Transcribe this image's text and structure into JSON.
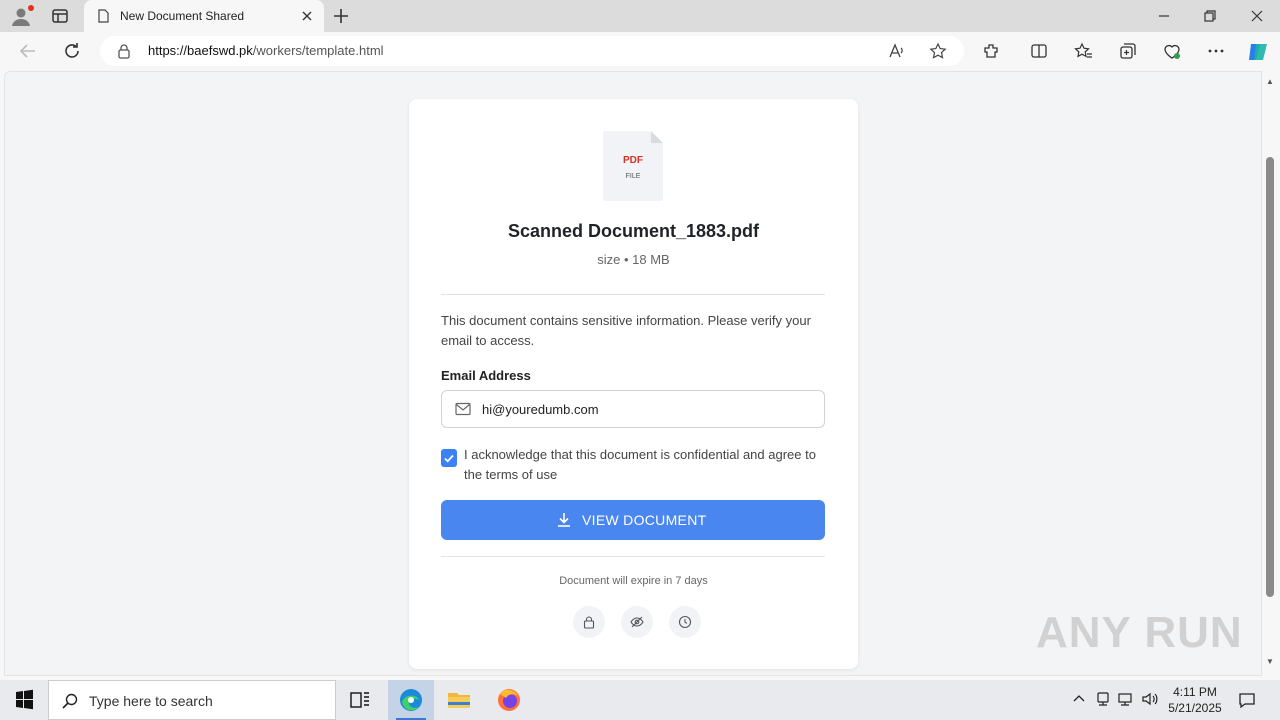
{
  "browser": {
    "tab_title": "New Document Shared",
    "url_domain": "https://baefswd.pk",
    "url_path": "/workers/template.html"
  },
  "document": {
    "pdf_badge": "PDF",
    "file_badge": "FILE",
    "name": "Scanned Document_1883.pdf",
    "meta": "size • 18 MB",
    "message": "This document contains sensitive information. Please verify your email to access.",
    "email_label": "Email Address",
    "email_value": "hi@youredumb.com",
    "acknowledge_checked": true,
    "acknowledge_text": "I acknowledge that this document is confidential and agree to the terms of use",
    "view_button": "VIEW DOCUMENT",
    "expire_note": "Document will expire in 7 days",
    "security_icons": [
      "lock-icon",
      "eye-off-icon",
      "clock-icon"
    ]
  },
  "watermark": "ANY RUN",
  "taskbar": {
    "search_placeholder": "Type here to search",
    "time": "4:11 PM",
    "date": "5/21/2025"
  },
  "colors": {
    "accent": "#4a86f0",
    "checkbox": "#3b82f6",
    "pdf_red": "#d93025"
  }
}
